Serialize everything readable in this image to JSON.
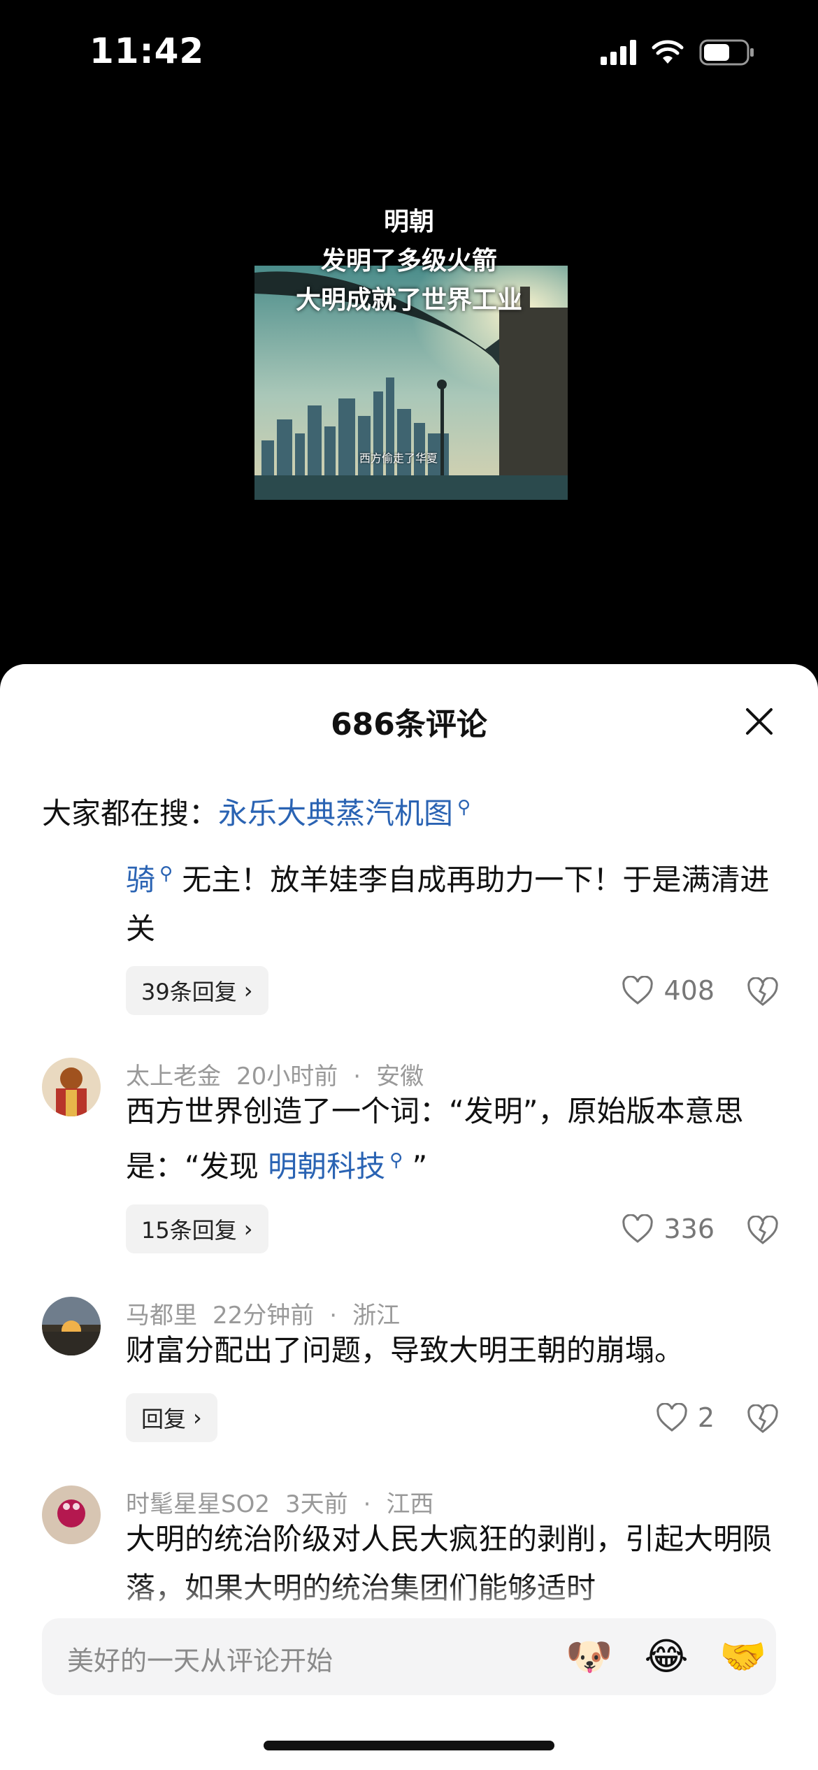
{
  "status_bar": {
    "time": "11:42"
  },
  "video": {
    "overlay_lines": [
      "明朝",
      "发明了多级火箭",
      "大明成就了世界工业"
    ],
    "inner_caption": "西方偷走了华夏"
  },
  "comments_panel": {
    "title": "686条评论",
    "hot_search": {
      "label": "大家都在搜：",
      "term": "永乐大典蒸汽机图"
    }
  },
  "comments": [
    {
      "text_link": "骑",
      "text": "无主！放羊娃李自成再助力一下！于是满清进关",
      "reply_label": "39条回复",
      "likes": "408"
    },
    {
      "user": "太上老金",
      "time": "20小时前",
      "location": "安徽",
      "text": "西方世界创造了一个词：“发明”，原始版本意思 是：“发现 ",
      "text_link": "明朝科技",
      "text_tail": "”",
      "reply_label": "15条回复",
      "likes": "336"
    },
    {
      "user": "马都里",
      "time": "22分钟前",
      "location": "浙江",
      "text": "财富分配出了问题，导致大明王朝的崩塌。",
      "reply_label": "回复",
      "likes": "2"
    },
    {
      "user": "时髦星星SO2",
      "time": "3天前",
      "location": "江西",
      "text": "大明的统治阶级对人民大疯狂的剥削，引起大明陨落，如果大明的统治集团们能够适时"
    }
  ],
  "input_bar": {
    "placeholder": "美好的一天从评论开始",
    "emojis": [
      "doge-emoji",
      "laugh-cry-emoji",
      "handshake-emoji"
    ]
  },
  "colors": {
    "link": "#2a63b3",
    "meta": "#999999"
  }
}
